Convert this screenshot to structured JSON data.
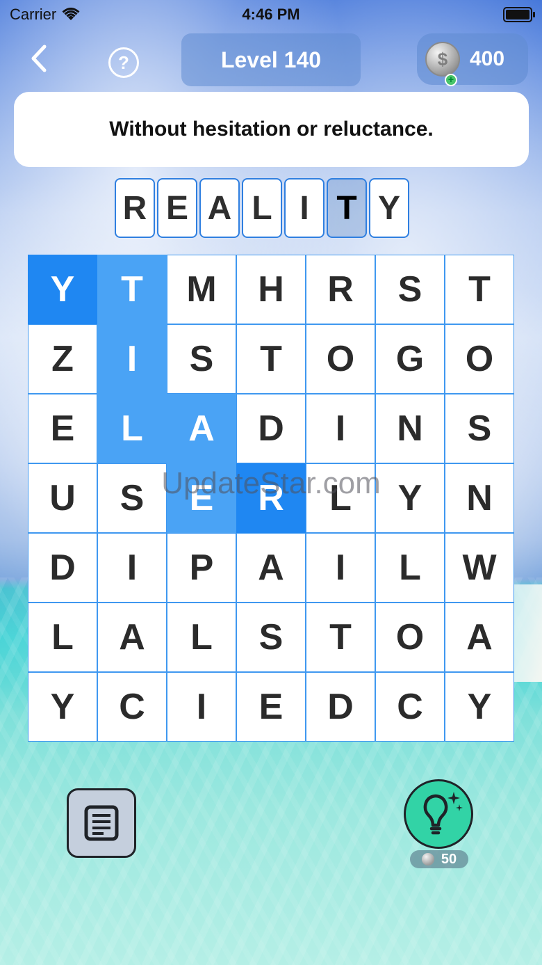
{
  "status_bar": {
    "carrier": "Carrier",
    "time": "4:46 PM"
  },
  "header": {
    "level_label": "Level 140",
    "coin_balance": "400",
    "help_symbol": "?"
  },
  "clue": "Without hesitation or reluctance.",
  "answer": {
    "letters": [
      "R",
      "E",
      "A",
      "L",
      "I",
      "T",
      "Y"
    ],
    "unrevealed_indices": [
      5
    ]
  },
  "grid": {
    "rows": [
      [
        "Y",
        "T",
        "M",
        "H",
        "R",
        "S",
        "T"
      ],
      [
        "Z",
        "I",
        "S",
        "T",
        "O",
        "G",
        "O"
      ],
      [
        "E",
        "L",
        "A",
        "D",
        "I",
        "N",
        "S"
      ],
      [
        "U",
        "S",
        "E",
        "R",
        "L",
        "Y",
        "N"
      ],
      [
        "D",
        "I",
        "P",
        "A",
        "I",
        "L",
        "W"
      ],
      [
        "L",
        "A",
        "L",
        "S",
        "T",
        "O",
        "A"
      ],
      [
        "Y",
        "C",
        "I",
        "E",
        "D",
        "C",
        "Y"
      ]
    ],
    "selected_path": [
      [
        0,
        0
      ],
      [
        0,
        1
      ],
      [
        1,
        1
      ],
      [
        2,
        1
      ],
      [
        2,
        2
      ],
      [
        3,
        2
      ],
      [
        3,
        3
      ]
    ],
    "selected_path_endpoints": [
      [
        0,
        0
      ],
      [
        3,
        3
      ]
    ]
  },
  "watermark": "UpdateStar.com",
  "hint": {
    "cost": "50"
  },
  "colors": {
    "grid_border": "#3f98f0",
    "selected": "#4aa3f5",
    "selected_end": "#1f87f2",
    "hint_button": "#32d3a6",
    "words_button": "#c5cfdd"
  },
  "icons": {
    "back": "chevron-left-icon",
    "help": "question-circle-icon",
    "coin": "coin-icon",
    "add_coins": "plus-icon",
    "words": "document-list-icon",
    "hint": "lightbulb-sparkle-icon"
  }
}
